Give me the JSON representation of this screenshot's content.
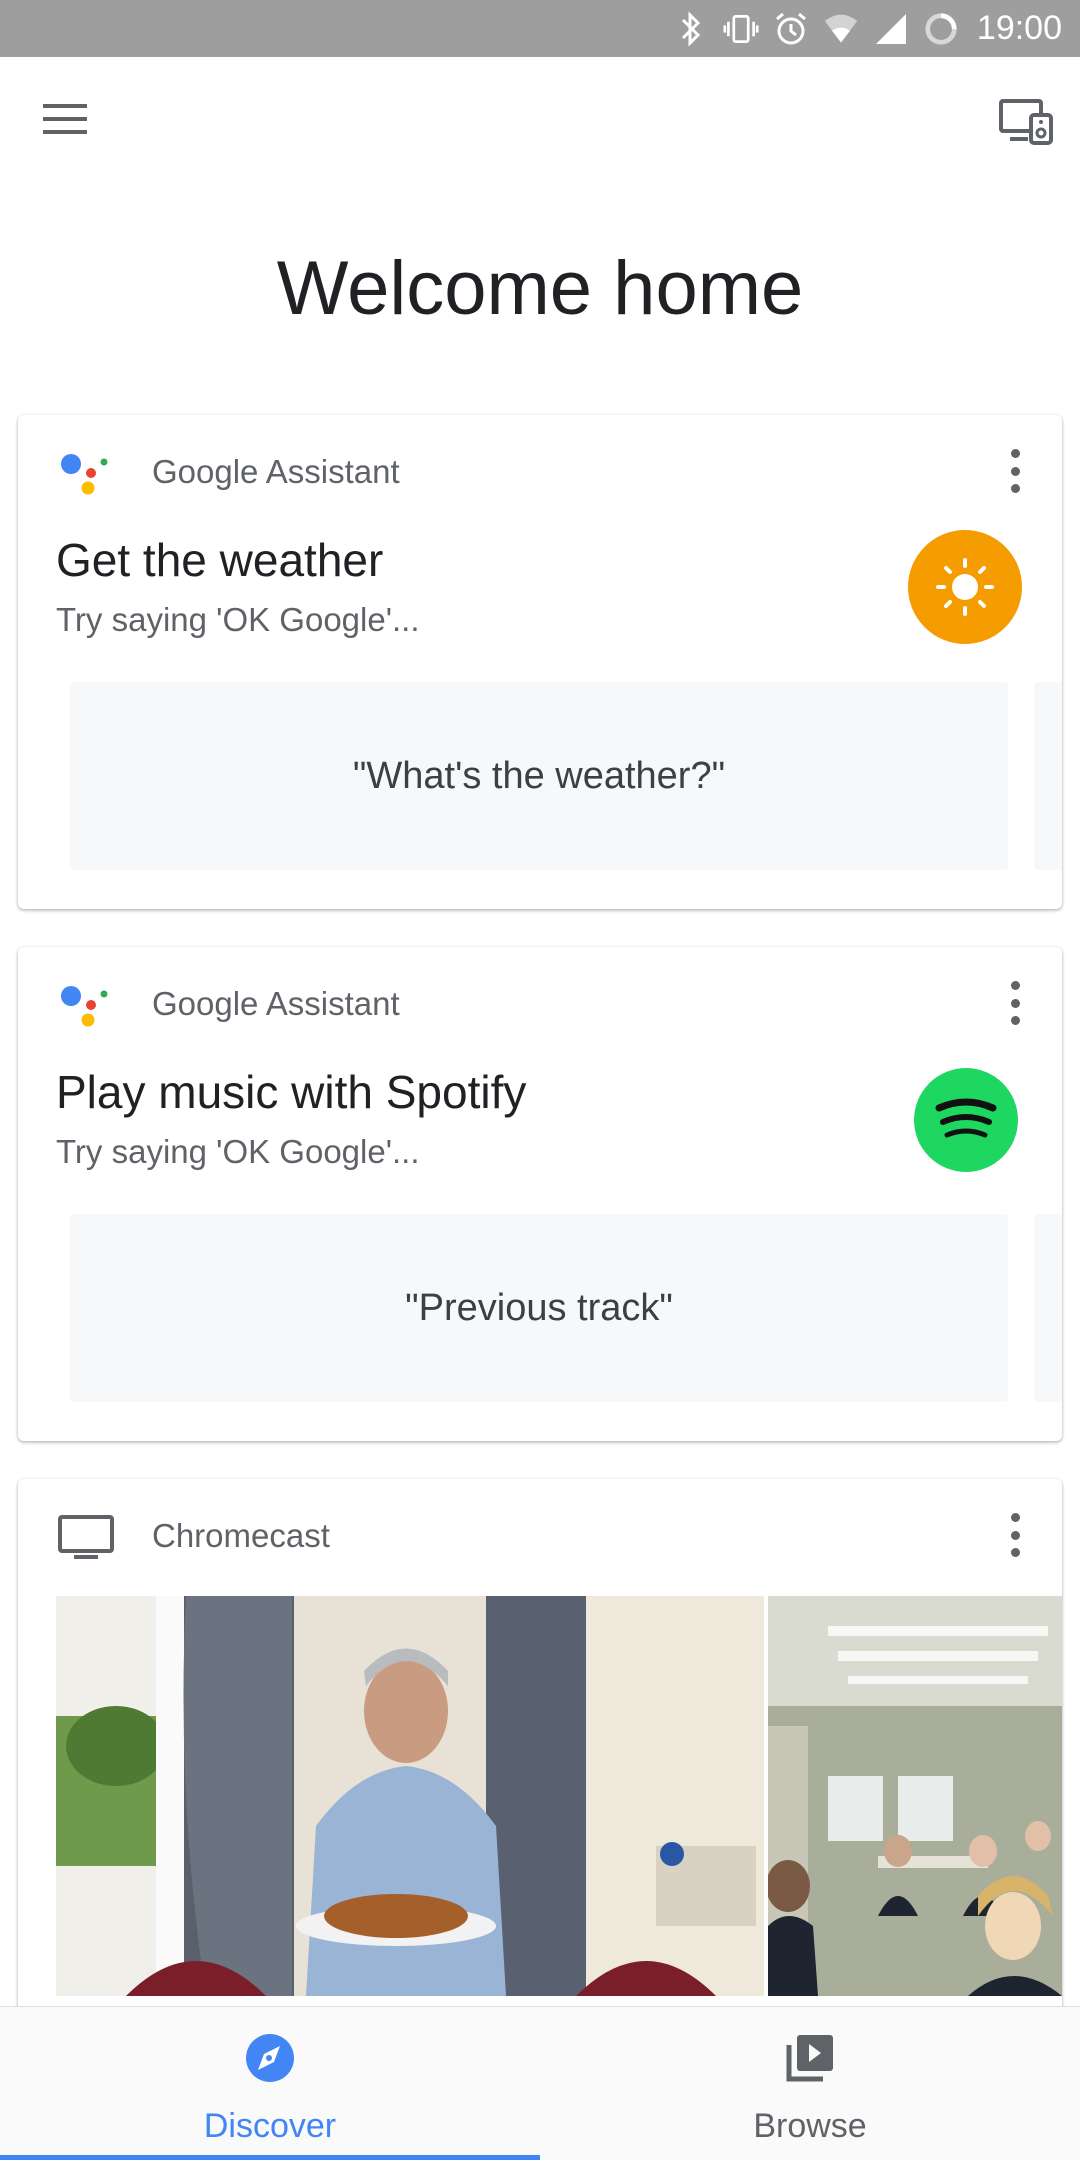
{
  "status_bar": {
    "time": "19:00"
  },
  "page": {
    "title": "Welcome home"
  },
  "cards": [
    {
      "source": "Google Assistant",
      "title": "Get the weather",
      "subtitle": "Try saying 'OK Google'...",
      "chip": "\"What's the weather?\"",
      "badge_icon": "sun-icon",
      "badge_color": "#f59c00"
    },
    {
      "source": "Google Assistant",
      "title": "Play music with Spotify",
      "subtitle": "Try saying 'OK Google'...",
      "chip": "\"Previous track\"",
      "badge_icon": "spotify-icon",
      "badge_color": "#1ed760"
    },
    {
      "source": "Chromecast"
    }
  ],
  "bottom_nav": {
    "items": [
      {
        "label": "Discover",
        "icon": "compass-icon",
        "active": true
      },
      {
        "label": "Browse",
        "icon": "video-library-icon",
        "active": false
      }
    ]
  },
  "colors": {
    "accent": "#4285f4",
    "status_bar": "#9e9e9e",
    "text_secondary": "#5f6368"
  }
}
